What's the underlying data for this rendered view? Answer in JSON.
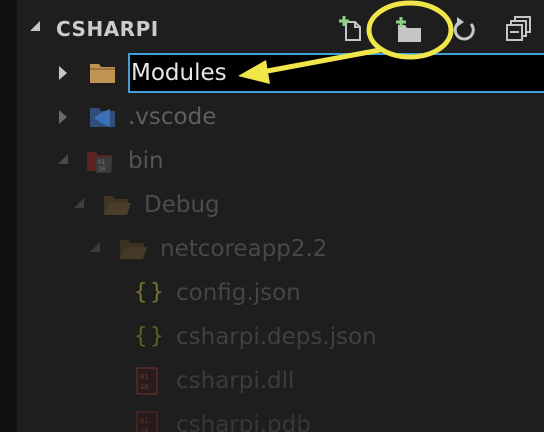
{
  "explorer": {
    "section_title": "CSHARPI",
    "toolbar": {
      "new_file_icon": "new-file-icon",
      "new_folder_icon": "new-folder-icon",
      "refresh_icon": "refresh-icon",
      "collapse_all_icon": "collapse-all-icon"
    }
  },
  "tree": {
    "rename_input_value": "Modules",
    "items": [
      {
        "label": "Modules",
        "kind": "folder",
        "expanded": false,
        "editing": true
      },
      {
        "label": ".vscode",
        "kind": "folder-vscode",
        "expanded": false
      },
      {
        "label": "bin",
        "kind": "folder-bin",
        "expanded": true
      },
      {
        "label": "Debug",
        "kind": "folder",
        "expanded": true
      },
      {
        "label": "netcoreapp2.2",
        "kind": "folder",
        "expanded": true
      },
      {
        "label": "config.json",
        "kind": "json-file"
      },
      {
        "label": "csharpi.deps.json",
        "kind": "json-file"
      },
      {
        "label": "csharpi.dll",
        "kind": "binary-file"
      },
      {
        "label": "csharpi.pdb",
        "kind": "binary-file"
      }
    ]
  },
  "annotation": {
    "highlight_color": "#f0e64a",
    "highlighted_control": "new-folder-icon"
  },
  "colors": {
    "background": "#1e1e1e",
    "focus_border": "#3f9fd8",
    "folder": "#c09553",
    "vscode_folder": "#3b6fb6",
    "bin_folder": "#8a2a2a",
    "json_braces": "#77732a"
  }
}
